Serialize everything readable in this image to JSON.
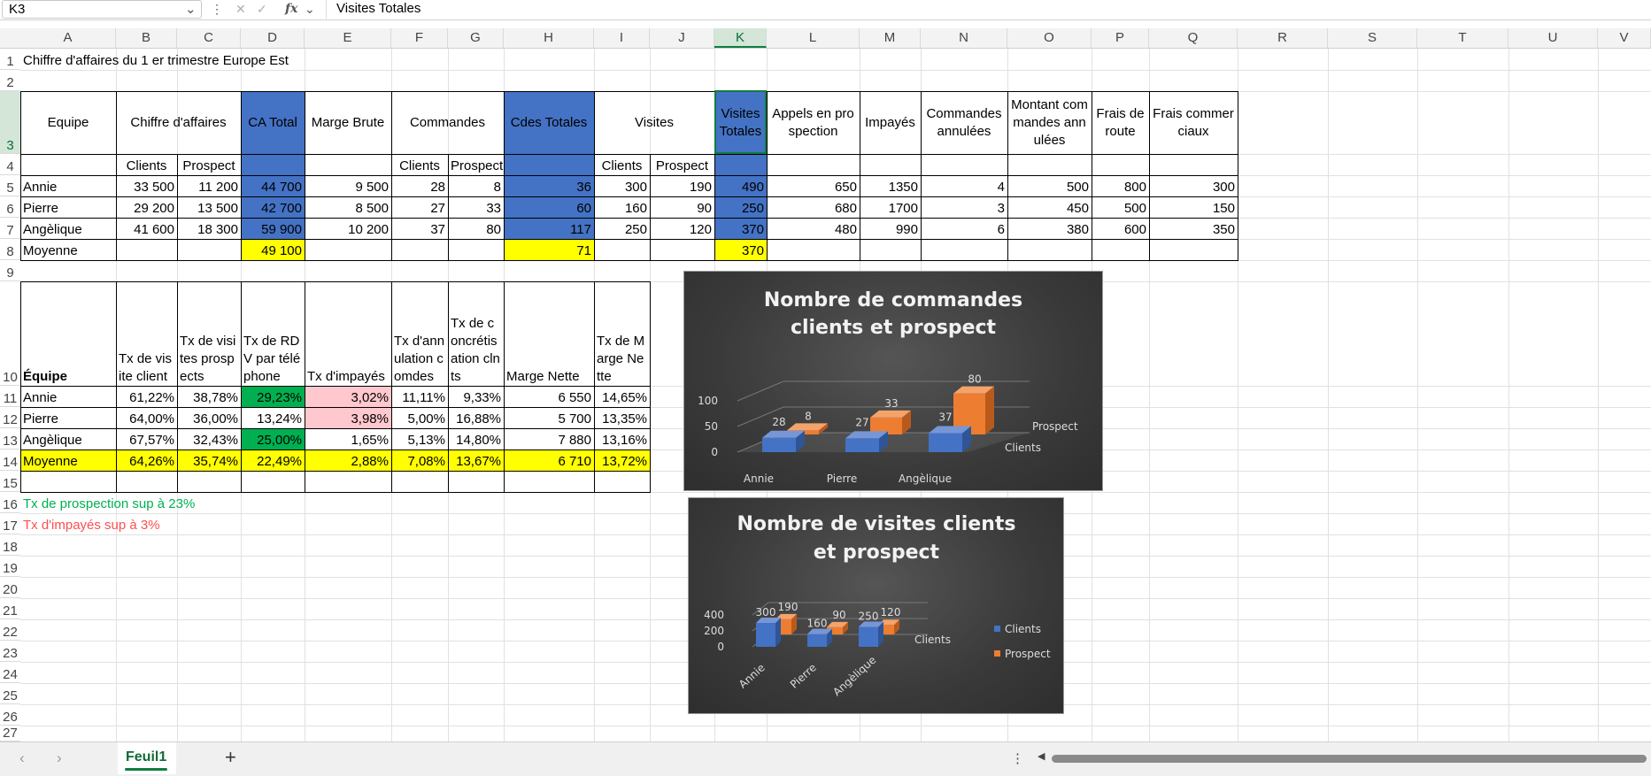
{
  "formula_bar": {
    "name_box": "K3",
    "formula": "Visites Totales"
  },
  "columns": [
    "A",
    "B",
    "C",
    "D",
    "E",
    "F",
    "G",
    "H",
    "I",
    "J",
    "K",
    "L",
    "M",
    "N",
    "O",
    "P",
    "Q",
    "R",
    "S",
    "T",
    "U",
    "V"
  ],
  "rows": [
    "1",
    "2",
    "3",
    "4",
    "5",
    "6",
    "7",
    "8",
    "9",
    "10",
    "11",
    "12",
    "13",
    "14",
    "15",
    "16",
    "17",
    "18",
    "19",
    "20",
    "21",
    "22",
    "23",
    "24",
    "25",
    "26",
    "27"
  ],
  "sheet": {
    "title": "Chiffre d'affaires du 1 er trimestre Europe Est",
    "h": {
      "equipe": "Equipe",
      "ca": "Chiffre d'affaires",
      "ca_total": "CA Total",
      "marge": "Marge Brute",
      "cmd": "Commandes",
      "cdes_tot": "Cdes Totales",
      "visites": "Visites",
      "visites_tot": "Visites Totales",
      "appels": "Appels en prospection",
      "impayes": "Impayés",
      "cmd_ann": "Commandes annulées",
      "montant": "Montant commandes annulées",
      "frais_route": "Frais de route",
      "frais_com": "Frais commerciaux"
    },
    "sub": {
      "clients": "Clients",
      "prospect": "Prospect"
    },
    "rows": [
      {
        "name": "Annie",
        "b": "33 500",
        "c": "11 200",
        "d": "44 700",
        "e": "9 500",
        "f": "28",
        "g": "8",
        "h": "36",
        "i": "300",
        "j": "190",
        "k": "490",
        "l": "650",
        "m": "1350",
        "n": "4",
        "o": "500",
        "p": "800",
        "q": "300"
      },
      {
        "name": "Pierre",
        "b": "29 200",
        "c": "13 500",
        "d": "42 700",
        "e": "8 500",
        "f": "27",
        "g": "33",
        "h": "60",
        "i": "160",
        "j": "90",
        "k": "250",
        "l": "680",
        "m": "1700",
        "n": "3",
        "o": "450",
        "p": "500",
        "q": "150"
      },
      {
        "name": "Angèlique",
        "b": "41 600",
        "c": "18 300",
        "d": "59 900",
        "e": "10 200",
        "f": "37",
        "g": "80",
        "h": "117",
        "i": "250",
        "j": "120",
        "k": "370",
        "l": "480",
        "m": "990",
        "n": "6",
        "o": "380",
        "p": "600",
        "q": "350"
      }
    ],
    "moyenne": {
      "label": "Moyenne",
      "d": "49 100",
      "h": "71",
      "k": "370"
    },
    "t2h": {
      "equipe": "Équipe",
      "b": "Tx de visite client",
      "c": "Tx de visites prospects",
      "d": "Tx de RDV par téléphone",
      "e": "Tx d'impayés",
      "f": "Tx d'annulation comdes",
      "g": "Tx de concrétisation clnts",
      "h": "Marge Nette",
      "i": "Tx de Marge Nette"
    },
    "t2": [
      {
        "name": "Annie",
        "b": "61,22%",
        "c": "38,78%",
        "d": "29,23%",
        "e": "3,02%",
        "f": "11,11%",
        "g": "9,33%",
        "h": "6 550",
        "i": "14,65%"
      },
      {
        "name": "Pierre",
        "b": "64,00%",
        "c": "36,00%",
        "d": "13,24%",
        "e": "3,98%",
        "f": "5,00%",
        "g": "16,88%",
        "h": "5 700",
        "i": "13,35%"
      },
      {
        "name": "Angèlique",
        "b": "67,57%",
        "c": "32,43%",
        "d": "25,00%",
        "e": "1,65%",
        "f": "5,13%",
        "g": "14,80%",
        "h": "7 880",
        "i": "13,16%"
      },
      {
        "name": "Moyenne",
        "b": "64,26%",
        "c": "35,74%",
        "d": "22,49%",
        "e": "2,88%",
        "f": "7,08%",
        "g": "13,67%",
        "h": "6 710",
        "i": "13,72%"
      }
    ],
    "note1": "Tx de prospection sup à 23%",
    "note2": "Tx d'impayés sup à 3%"
  },
  "chart1": {
    "title_line1": "Nombre de commandes",
    "title_line2": "clients et prospect",
    "chart_data": {
      "type": "bar",
      "categories": [
        "Annie",
        "Pierre",
        "Angèlique"
      ],
      "series": [
        {
          "name": "Clients",
          "values": [
            28,
            27,
            37
          ]
        },
        {
          "name": "Prospect",
          "values": [
            8,
            33,
            80
          ]
        }
      ],
      "ylim": [
        0,
        100
      ],
      "yticks": [
        "0",
        "50",
        "100"
      ]
    }
  },
  "chart2": {
    "title_line1": "Nombre de visites clients",
    "title_line2": "et prospect",
    "axis_series": "Clients",
    "legend": [
      "Clients",
      "Prospect"
    ],
    "chart_data": {
      "type": "bar",
      "categories": [
        "Annie",
        "Pierre",
        "Angèlique"
      ],
      "series": [
        {
          "name": "Clients",
          "values": [
            300,
            160,
            250
          ]
        },
        {
          "name": "Prospect",
          "values": [
            190,
            90,
            120
          ]
        }
      ],
      "ylim": [
        0,
        400
      ],
      "yticks": [
        "0",
        "200",
        "400"
      ]
    }
  },
  "tabs": {
    "sheet1": "Feuil1",
    "add": "+"
  },
  "colors": {
    "blue": "#4472c4",
    "orange": "#ed7d31",
    "yellow": "#ffff00",
    "green": "#00b050",
    "pink": "#ffc7ce",
    "excel_green": "#107c41"
  }
}
